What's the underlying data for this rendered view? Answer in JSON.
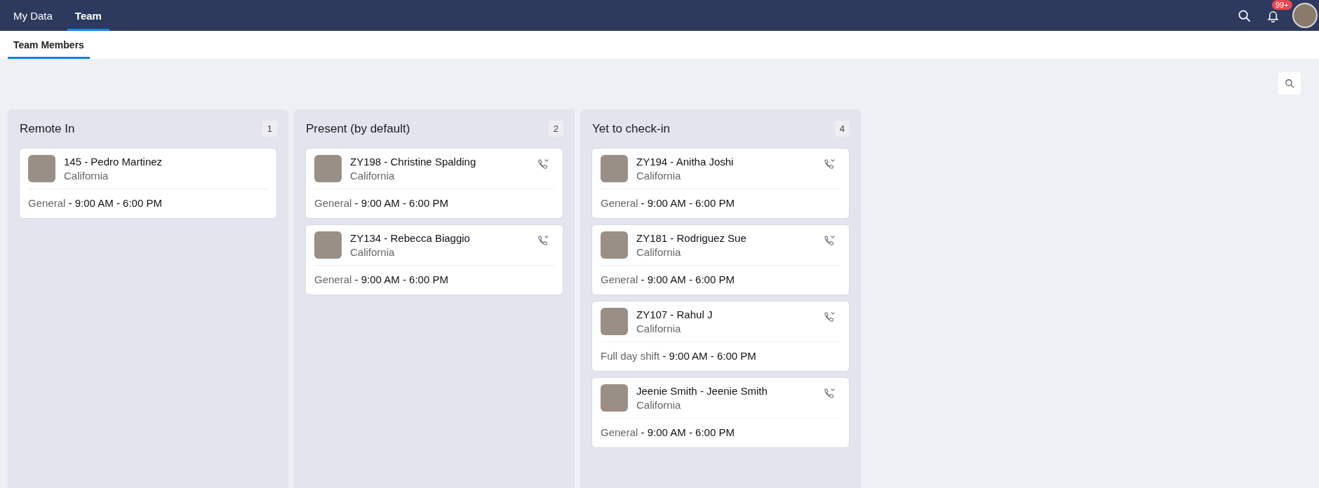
{
  "top_nav": {
    "tabs": [
      {
        "label": "My Data",
        "selected": false
      },
      {
        "label": "Team",
        "selected": true
      }
    ],
    "notifications_badge": "99+"
  },
  "sub_nav": {
    "tabs": [
      {
        "label": "Team Members",
        "selected": true
      }
    ]
  },
  "columns": [
    {
      "title": "Remote In",
      "count": "1",
      "cards": [
        {
          "name": "145 - Pedro Martinez",
          "location": "California",
          "shift": "General",
          "time": "- 9:00 AM - 6:00 PM",
          "call_button": false
        }
      ]
    },
    {
      "title": "Present (by default)",
      "count": "2",
      "cards": [
        {
          "name": "ZY198 - Christine Spalding",
          "location": "California",
          "shift": "General",
          "time": "- 9:00 AM - 6:00 PM",
          "call_button": true
        },
        {
          "name": "ZY134 - Rebecca Biaggio",
          "location": "California",
          "shift": "General",
          "time": "- 9:00 AM - 6:00 PM",
          "call_button": true
        }
      ]
    },
    {
      "title": "Yet to check-in",
      "count": "4",
      "cards": [
        {
          "name": "ZY194 - Anitha Joshi",
          "location": "California",
          "shift": "General",
          "time": "- 9:00 AM - 6:00 PM",
          "call_button": true
        },
        {
          "name": "ZY181 - Rodriguez Sue",
          "location": "California",
          "shift": "General",
          "time": "- 9:00 AM - 6:00 PM",
          "call_button": true
        },
        {
          "name": "ZY107 - Rahul J",
          "location": "California",
          "shift": "Full day shift",
          "time": "- 9:00 AM - 6:00 PM",
          "call_button": true
        },
        {
          "name": "Jeenie Smith - Jeenie Smith",
          "location": "California",
          "shift": "General",
          "time": "- 9:00 AM - 6:00 PM",
          "call_button": true
        }
      ]
    }
  ]
}
